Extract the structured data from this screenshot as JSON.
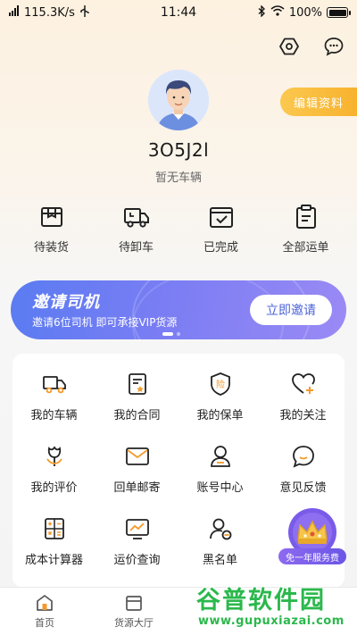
{
  "status_bar": {
    "speed": "115.3K/s",
    "time": "11:44",
    "battery": "100%"
  },
  "profile": {
    "edit_label": "编辑资料",
    "username": "3O5J2l",
    "vehicle_status": "暂无车辆"
  },
  "orders": [
    {
      "label": "待装货",
      "icon": "package-box-icon"
    },
    {
      "label": "待卸车",
      "icon": "delivery-truck-icon"
    },
    {
      "label": "已完成",
      "icon": "completed-check-icon"
    },
    {
      "label": "全部运单",
      "icon": "clipboard-list-icon"
    }
  ],
  "banner": {
    "title": "邀请司机",
    "subtitle": "邀请6位司机 即可承接VIP货源",
    "button": "立即邀请"
  },
  "services": [
    {
      "label": "我的车辆",
      "icon": "truck-icon"
    },
    {
      "label": "我的合同",
      "icon": "contract-icon"
    },
    {
      "label": "我的保单",
      "icon": "insurance-shield-icon",
      "badge": "险"
    },
    {
      "label": "我的关注",
      "icon": "heart-plus-icon"
    },
    {
      "label": "我的评价",
      "icon": "flower-rating-icon"
    },
    {
      "label": "回单邮寄",
      "icon": "envelope-icon"
    },
    {
      "label": "账号中心",
      "icon": "user-account-icon"
    },
    {
      "label": "意见反馈",
      "icon": "chat-feedback-icon"
    },
    {
      "label": "成本计算器",
      "icon": "calculator-icon"
    },
    {
      "label": "运价查询",
      "icon": "price-chart-icon"
    },
    {
      "label": "黑名单",
      "icon": "blacklist-user-icon"
    }
  ],
  "vip_promo": {
    "label": "免一年服务费"
  },
  "tabs": [
    {
      "label": "首页",
      "icon": "home-icon"
    },
    {
      "label": "货源大厅",
      "icon": "cargo-hall-icon"
    }
  ],
  "watermark": {
    "top": "谷普软件园",
    "bottom": "www.gupuxiazai.com"
  },
  "colors": {
    "accent": "#f7b22e",
    "banner": "#6a7df3",
    "icon_orange": "#f39a2b",
    "watermark": "#2bb84c"
  }
}
